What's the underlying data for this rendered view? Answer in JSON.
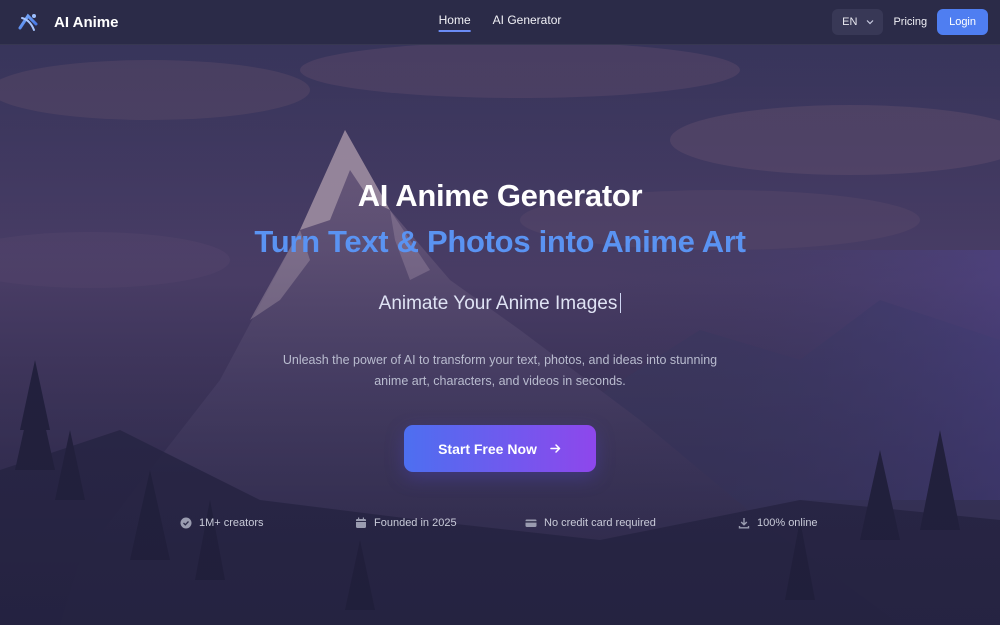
{
  "nav": {
    "brand": "AI Anime",
    "links": [
      {
        "label": "Home",
        "active": true
      },
      {
        "label": "AI Generator",
        "active": false
      }
    ],
    "language": "EN",
    "pricing": "Pricing",
    "login": "Login"
  },
  "hero": {
    "title": "AI Anime Generator",
    "subtitle": "Turn Text & Photos into Anime Art",
    "typed_text": "Animate Your Anime Images",
    "description": "Unleash the power of AI to transform your text, photos, and ideas into stunning anime art, characters, and videos in seconds.",
    "cta": "Start Free Now"
  },
  "features": [
    {
      "icon": "check-circle-icon",
      "label": "1M+ creators"
    },
    {
      "icon": "calendar-icon",
      "label": "Founded in 2025"
    },
    {
      "icon": "credit-card-icon",
      "label": "No credit card required"
    },
    {
      "icon": "download-icon",
      "label": "100% online"
    }
  ],
  "colors": {
    "accent": "#4f7ef1",
    "subtitle": "#5a93f2",
    "cta_start": "#4d6ff0",
    "cta_end": "#8e47ec"
  }
}
